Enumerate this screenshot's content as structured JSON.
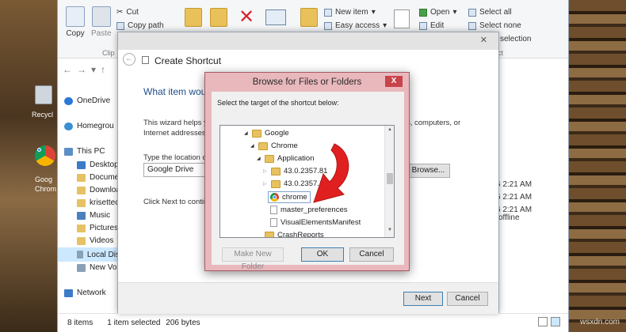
{
  "ribbon": {
    "copy": "Copy",
    "paste": "Paste",
    "cut": "Cut",
    "copy_path": "Copy path",
    "clip": "Clip",
    "new_item": "New item",
    "easy_access": "Easy access",
    "open": "Open",
    "edit": "Edit",
    "select_all": "Select all",
    "select_none": "Select none",
    "invert_selection": "selection",
    "select_section": "ect"
  },
  "nav": {
    "items": [
      {
        "label": "OneDrive"
      },
      {
        "label": "Homegrou"
      },
      {
        "label": "This PC"
      },
      {
        "label": "Desktop"
      },
      {
        "label": "Docume"
      },
      {
        "label": "Downloa"
      },
      {
        "label": "krisettec"
      },
      {
        "label": "Music"
      },
      {
        "label": "Pictures"
      },
      {
        "label": "Videos"
      },
      {
        "label": "Local Dis"
      },
      {
        "label": "New Vol"
      },
      {
        "label": "Network"
      }
    ]
  },
  "right_column": {
    "time1": "6 2:21 AM",
    "time2": "6 2:21 AM",
    "time3": "6 2:21 AM",
    "offline": "offline"
  },
  "status": {
    "items": "8 items",
    "selected": "1 item selected",
    "size": "206 bytes"
  },
  "desktop": {
    "recycle": "Recycl",
    "google": "Goog",
    "chrome": "Chrom"
  },
  "wizard": {
    "title": "Create Shortcut",
    "heading": "What item wou",
    "desc_line1": "This wizard helps y",
    "desc_line2": "Internet addresses.",
    "desc_right": "s, computers, or",
    "type_label": "Type the location o",
    "location_value": "Google Drive",
    "browse": "Browse...",
    "click_next": "Click Next to contin",
    "next": "Next",
    "cancel": "Cancel"
  },
  "browse_dialog": {
    "title": "Browse for Files or Folders",
    "close": "X",
    "prompt": "Select the target of the shortcut below:",
    "tree": [
      {
        "label": "Google"
      },
      {
        "label": "Chrome"
      },
      {
        "label": "Application"
      },
      {
        "label": "43.0.2357.81"
      },
      {
        "label": "43.0.2357.124"
      },
      {
        "label": "chrome"
      },
      {
        "label": "master_preferences"
      },
      {
        "label": "VisualElementsManifest"
      },
      {
        "label": "CrashReports"
      }
    ],
    "make_new_folder": "Make New Folder",
    "ok": "OK",
    "cancel": "Cancel"
  },
  "watermark": "wsxdn.com",
  "colors": {
    "accent_blue": "#1f4e8c",
    "dialog_frame": "#e9b8bc",
    "close_red": "#c9434a",
    "arrow_red": "#e02020"
  }
}
